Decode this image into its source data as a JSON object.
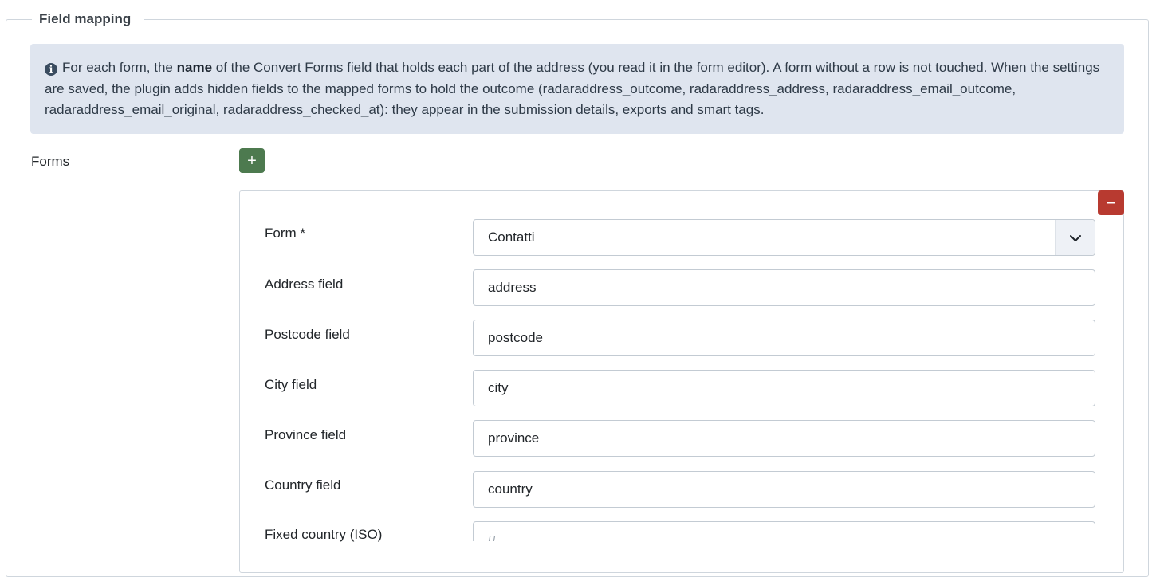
{
  "fieldset": {
    "legend": "Field mapping"
  },
  "info": {
    "text_before": "For each form, the ",
    "text_bold": "name",
    "text_after": " of the Convert Forms field that holds each part of the address (you read it in the form editor). A form without a row is not touched. When the settings are saved, the plugin adds hidden fields to the mapped forms to hold the outcome (radaraddress_outcome, radaraddress_address, radaraddress_email_outcome, radaraddress_email_original, radaraddress_checked_at): they appear in the submission details, exports and smart tags.",
    "icon": "info-circle-icon"
  },
  "forms": {
    "label": "Forms",
    "add_button": "+",
    "remove_button": "−"
  },
  "rows": [
    {
      "label": "Form *",
      "value": "Contatti",
      "type": "select"
    },
    {
      "label": "Address field",
      "value": "address",
      "type": "text"
    },
    {
      "label": "Postcode field",
      "value": "postcode",
      "type": "text"
    },
    {
      "label": "City field",
      "value": "city",
      "type": "text"
    },
    {
      "label": "Province field",
      "value": "province",
      "type": "text"
    },
    {
      "label": "Country field",
      "value": "country",
      "type": "text"
    },
    {
      "label": "Fixed country (ISO)",
      "placeholder": "IT",
      "type": "text"
    }
  ],
  "colors": {
    "add": "#4d7a4f",
    "remove": "#b83a30",
    "info_bg": "#dfe5ef"
  }
}
